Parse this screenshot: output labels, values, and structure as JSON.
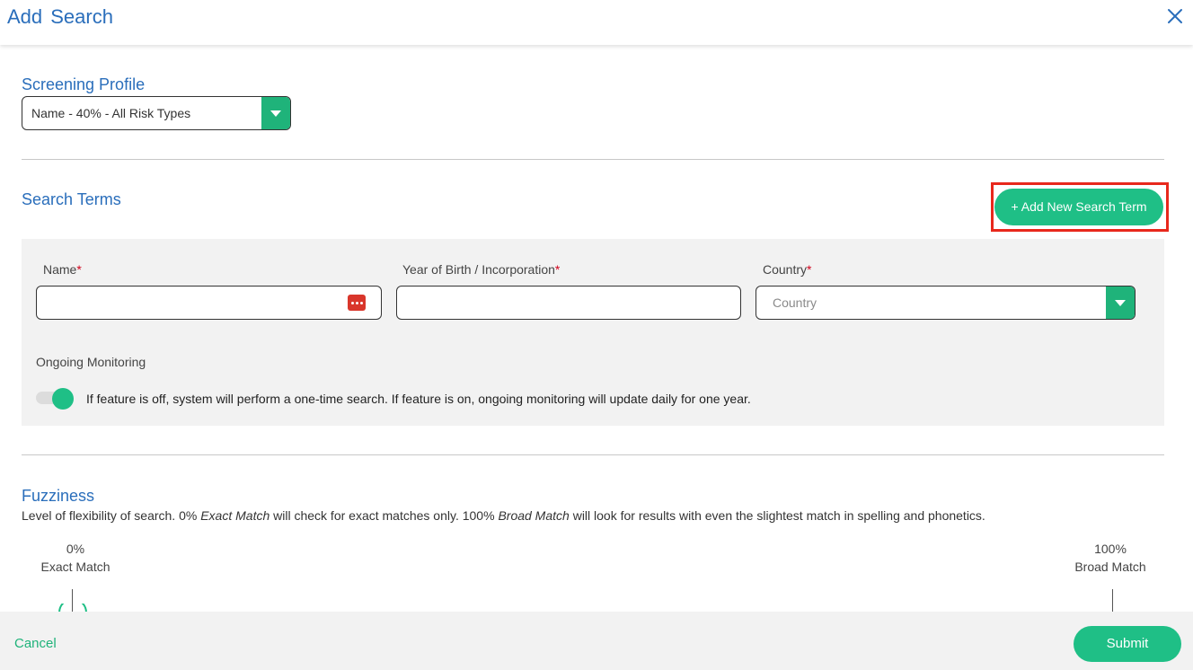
{
  "header": {
    "title": "Add Search",
    "close_icon": "close-icon"
  },
  "screening_profile": {
    "title": "Screening Profile",
    "selected": "Name - 40% - All Risk Types"
  },
  "search_terms": {
    "title": "Search Terms",
    "add_button": "+ Add New Search Term",
    "fields": {
      "name_label": "Name",
      "yob_label": "Year of Birth / Incorporation",
      "country_label": "Country",
      "country_placeholder": "Country",
      "required_mark": "*"
    },
    "monitoring": {
      "label": "Ongoing Monitoring",
      "enabled": true,
      "description": "If feature is off, system will perform a one-time search. If feature is on, ongoing monitoring will update daily for one year."
    }
  },
  "fuzziness": {
    "title": "Fuzziness",
    "desc_part1": "Level of flexibility of search. 0% ",
    "desc_em1": "Exact Match",
    "desc_part2": " will check for exact matches only. 100% ",
    "desc_em2": "Broad Match",
    "desc_part3": " will look for results with even the slightest match in spelling and phonetics.",
    "min_percent": "0%",
    "min_label": "Exact Match",
    "max_percent": "100%",
    "max_label": "Broad Match"
  },
  "footer": {
    "cancel": "Cancel",
    "submit": "Submit"
  },
  "colors": {
    "accent": "#1fbf86",
    "title_blue": "#2a6ebb",
    "highlight": "#e8281c"
  }
}
